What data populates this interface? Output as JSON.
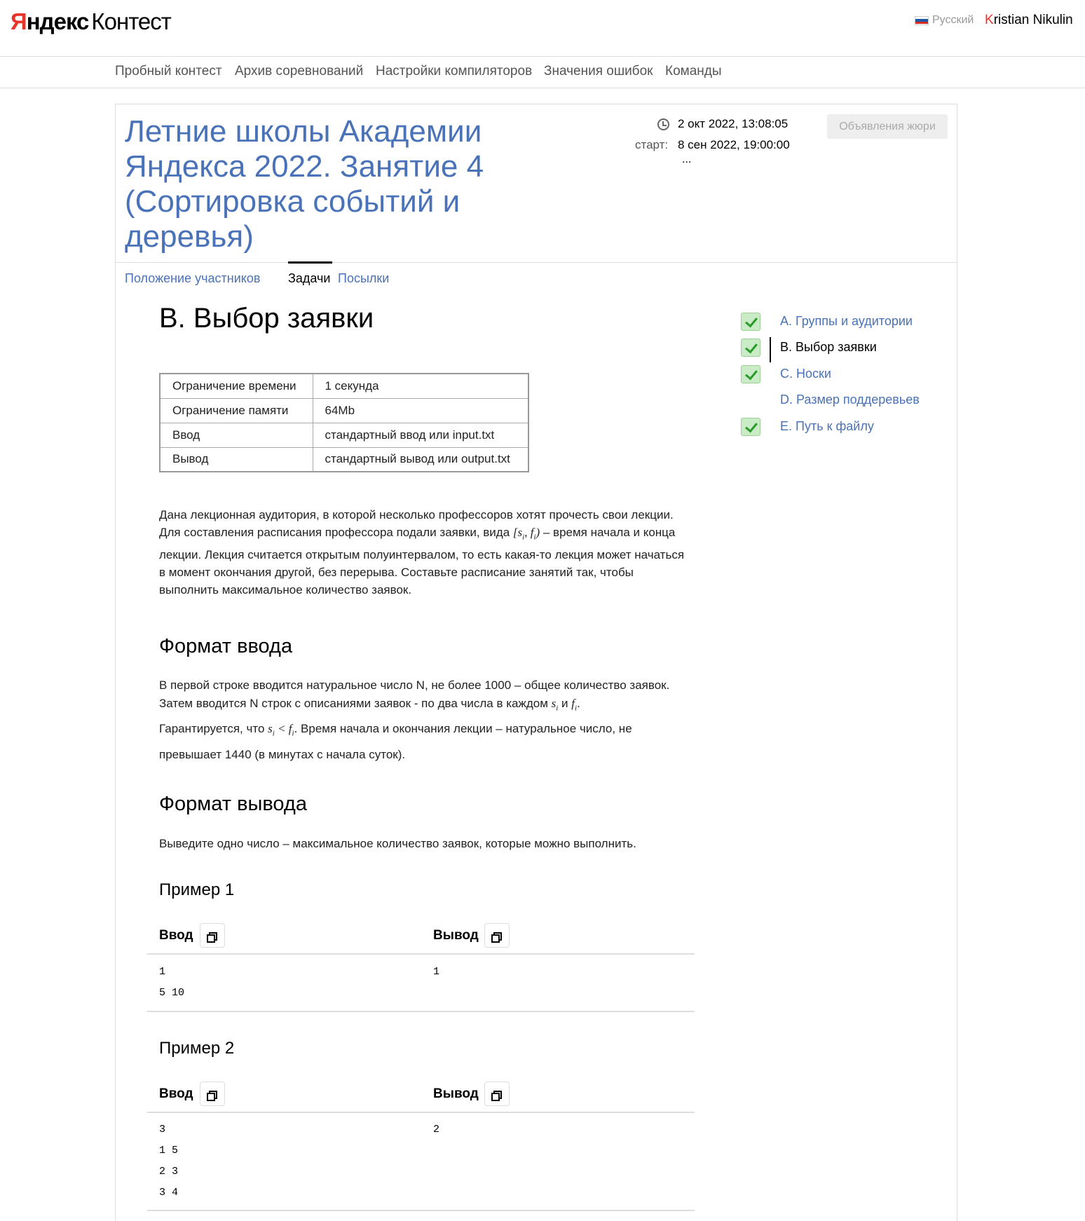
{
  "header": {
    "logo_ya": "Я",
    "logo_ndex": "ндекс",
    "logo_kontest": "Контест",
    "language": "Русский",
    "user_first_letter": "K",
    "user_rest": "ristian Nikulin",
    "flag_colors": [
      "#ffffff",
      "#1c57a5",
      "#d52b1e"
    ]
  },
  "nav": {
    "items": [
      "Пробный контест",
      "Архив соревнований",
      "Настройки компиляторов",
      "Значения ошибок",
      "Команды"
    ]
  },
  "contest": {
    "title": "Летние школы Академии Яндекса 2022. Занятие 4 (Сортировка событий и деревья)",
    "current_time": "2 окт 2022, 13:08:05",
    "start_label": "старт:",
    "start_time": "8 сен 2022, 19:00:00",
    "ellipsis": "...",
    "jury_button": "Объявления жюри",
    "tabs": [
      "Положение участников",
      "Задачи",
      "Посылки"
    ],
    "active_tab": "Задачи"
  },
  "problem": {
    "title": "B. Выбор заявки",
    "limits": [
      {
        "key": "Ограничение времени",
        "value": "1 секунда"
      },
      {
        "key": "Ограничение памяти",
        "value": "64Mb"
      },
      {
        "key": "Ввод",
        "value": "стандартный ввод или input.txt"
      },
      {
        "key": "Вывод",
        "value": "стандартный вывод или output.txt"
      }
    ],
    "statement": {
      "line1": "Дана лекционная аудитория, в которой несколько профессоров хотят прочесть свои лекции.",
      "line2_a": "Для составления расписания профессора подали заявки, вида ",
      "line2_b": " – время начала и конца",
      "line3": "лекции. Лекция считается открытым полуинтервалом, то есть какая-то лекция может начаться",
      "line4": "в момент окончания другой, без перерыва. Составьте расписание занятий так, чтобы",
      "line5": "выполнить максимальное количество заявок."
    },
    "input_format_title": "Формат ввода",
    "input_format": {
      "line1": "В первой строке вводится натуральное число N, не более 1000 – общее количество заявок.",
      "line2_a": "Затем вводится N строк с описаниями заявок - по два числа в каждом ",
      "line2_b": " и ",
      "line3_a": "Гарантируется, что ",
      "line3_b": ". Время начала и окончания лекции – натуральное число, не",
      "line4": "превышает 1440 (в минутах с начала суток)."
    },
    "output_format_title": "Формат вывода",
    "output_format": "Выведите одно число – максимальное количество заявок, которые можно выполнить.",
    "examples": [
      {
        "title": "Пример 1",
        "input_label": "Ввод",
        "output_label": "Вывод",
        "input": "1\n5 10",
        "output": "1"
      },
      {
        "title": "Пример 2",
        "input_label": "Ввод",
        "output_label": "Вывод",
        "input": "3\n1 5\n2 3\n3 4",
        "output": "2"
      }
    ]
  },
  "problem_list": [
    {
      "name": "A. Группы и аудитории",
      "solved": true,
      "current": false
    },
    {
      "name": "B. Выбор заявки",
      "solved": true,
      "current": true
    },
    {
      "name": "C. Носки",
      "solved": true,
      "current": false
    },
    {
      "name": "D. Размер поддеревьев",
      "solved": false,
      "current": false
    },
    {
      "name": "E. Путь к файлу",
      "solved": true,
      "current": false
    }
  ],
  "colors": {
    "link": "#4a72b8",
    "brand_red": "#e8352c",
    "check_bg": "#c9ecc6",
    "check_mark": "#2a9a2a"
  }
}
